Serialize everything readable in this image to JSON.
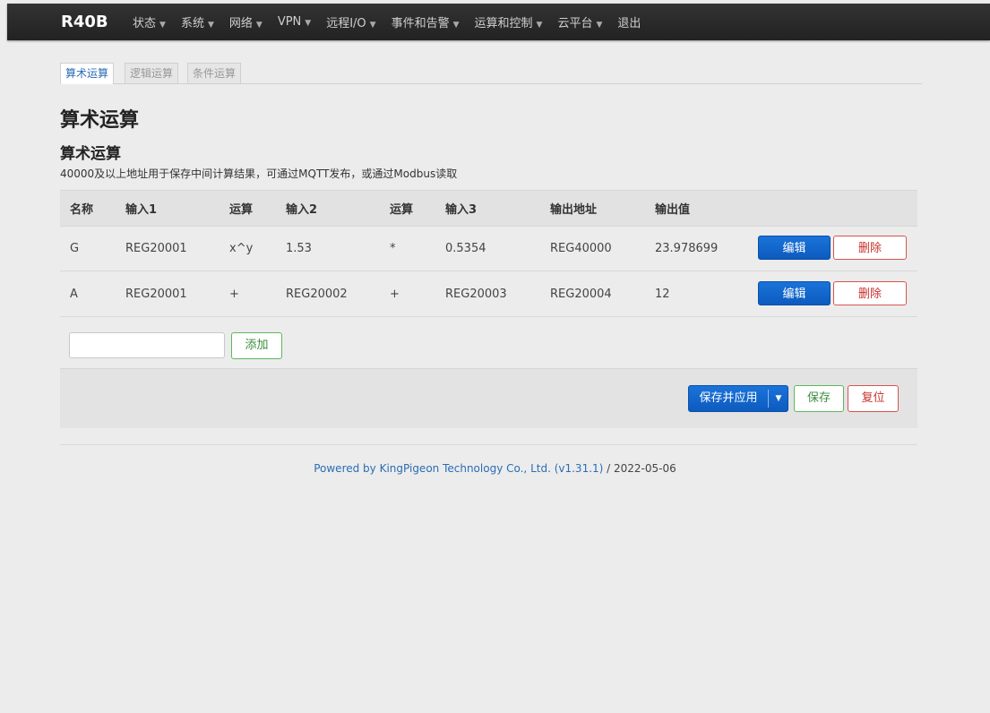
{
  "nav": {
    "brand": "R40B",
    "menu": [
      {
        "label": "状态",
        "dropdown": true
      },
      {
        "label": "系统",
        "dropdown": true
      },
      {
        "label": "网络",
        "dropdown": true
      },
      {
        "label": "VPN",
        "dropdown": true
      },
      {
        "label": "远程I/O",
        "dropdown": true
      },
      {
        "label": "事件和告警",
        "dropdown": true
      },
      {
        "label": "运算和控制",
        "dropdown": true
      },
      {
        "label": "云平台",
        "dropdown": true
      },
      {
        "label": "退出",
        "dropdown": false
      }
    ]
  },
  "tabs": [
    {
      "label": "算术运算",
      "active": true
    },
    {
      "label": "逻辑运算",
      "active": false
    },
    {
      "label": "条件运算",
      "active": false
    }
  ],
  "page": {
    "title": "算术运算",
    "section_title": "算术运算",
    "description": "40000及以上地址用于保存中间计算结果，可通过MQTT发布，或通过Modbus读取"
  },
  "table": {
    "headers": [
      "名称",
      "输入1",
      "运算",
      "输入2",
      "运算",
      "输入3",
      "输出地址",
      "输出值"
    ],
    "rows": [
      [
        "G",
        "REG20001",
        "x^y",
        "1.53",
        "*",
        "0.5354",
        "REG40000",
        "23.978699"
      ],
      [
        "A",
        "REG20001",
        "+",
        "REG20002",
        "+",
        "REG20003",
        "REG20004",
        "12"
      ]
    ],
    "edit_label": "编辑",
    "delete_label": "删除"
  },
  "add": {
    "input_value": "",
    "button_label": "添加"
  },
  "actions": {
    "apply_label": "保存并应用",
    "save_label": "保存",
    "reset_label": "复位"
  },
  "footer": {
    "link_text": "Powered by KingPigeon Technology Co., Ltd. (v1.31.1)",
    "date_text": " / 2022-05-06"
  }
}
